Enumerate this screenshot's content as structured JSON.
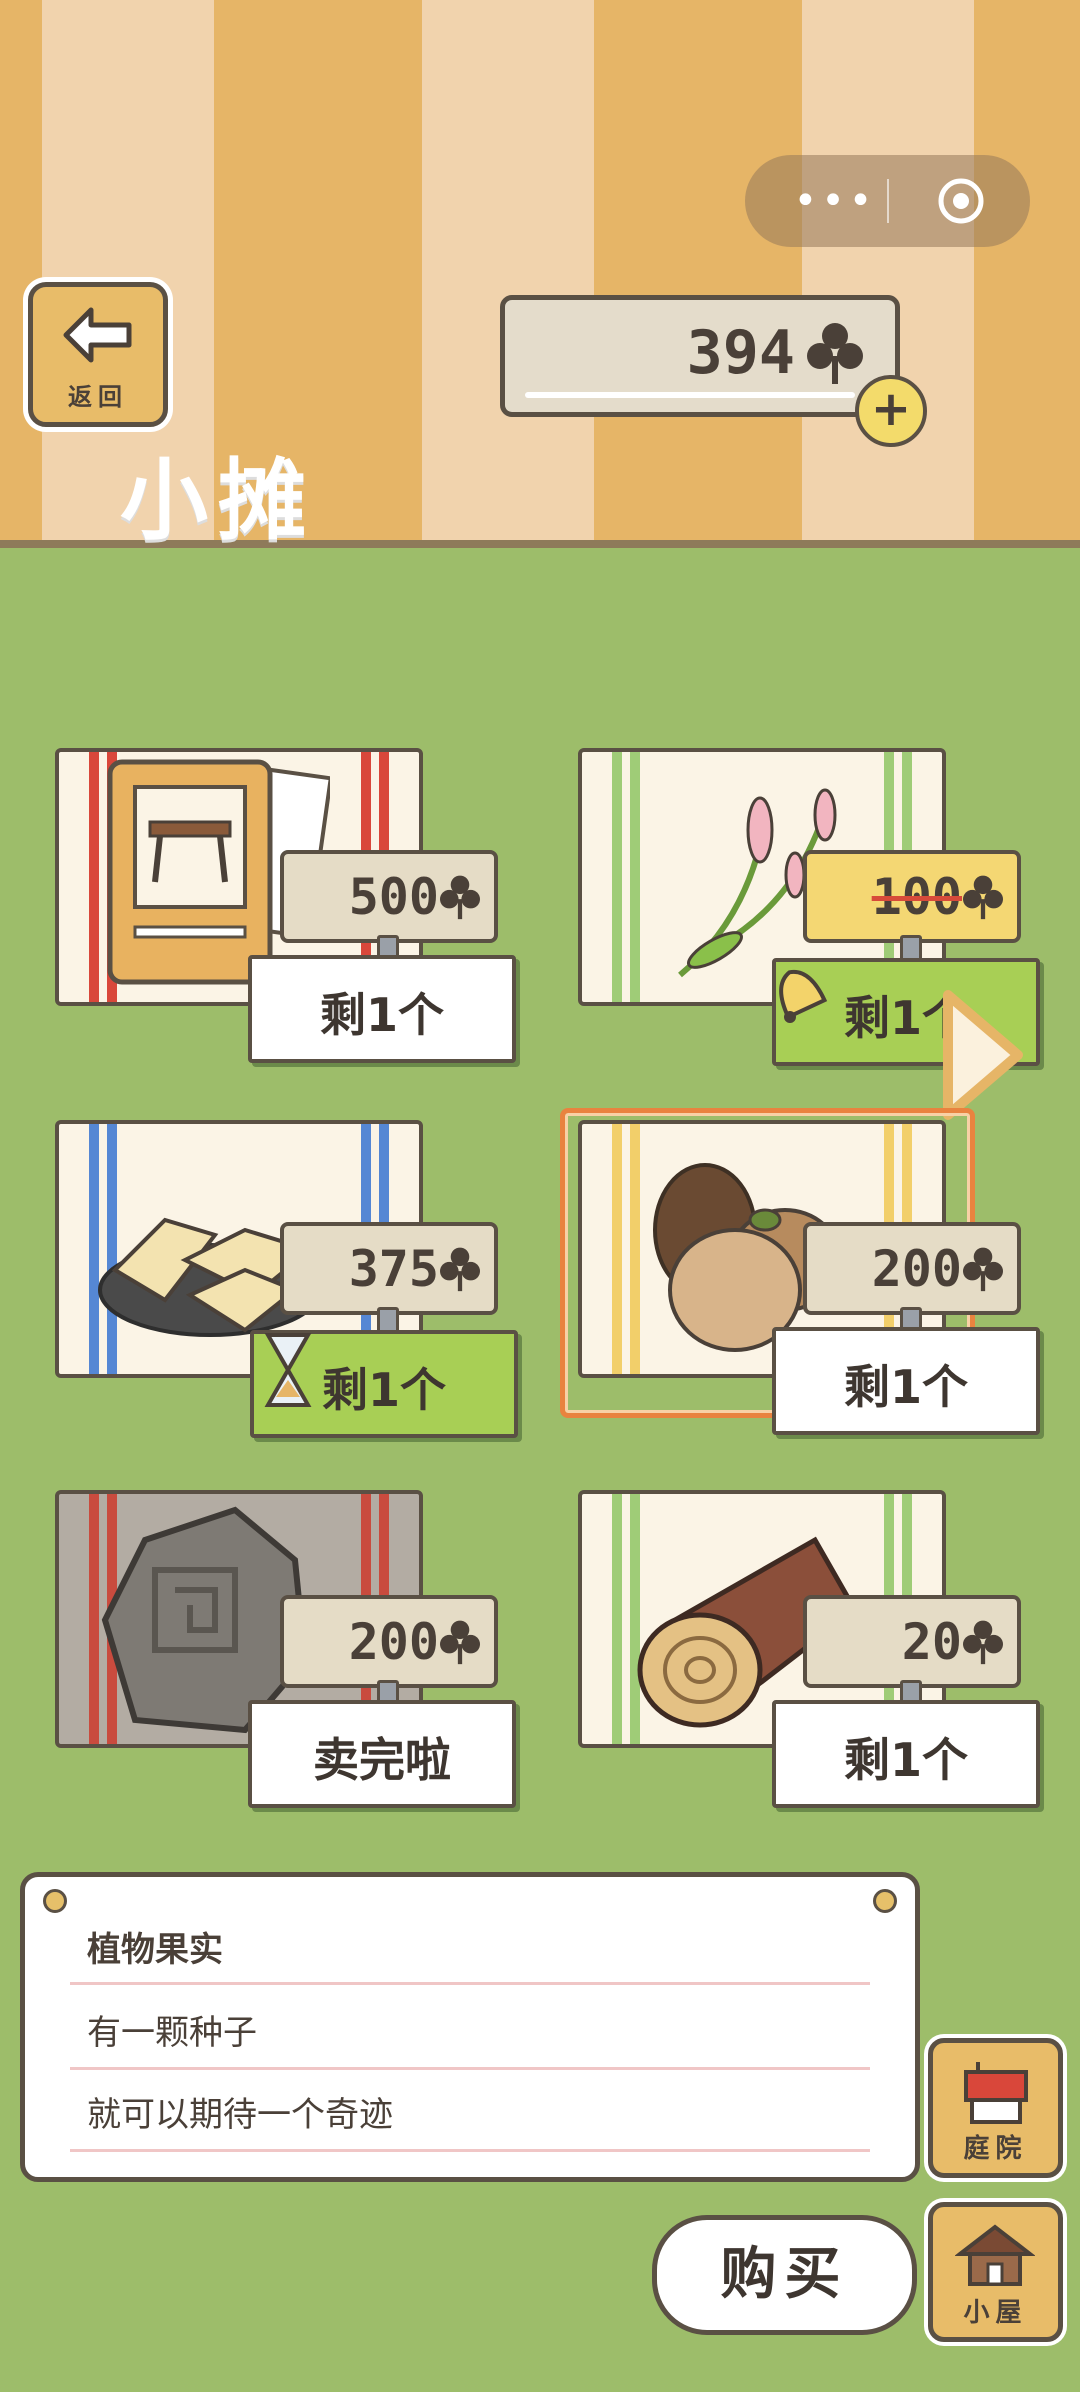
{
  "header": {
    "back_label": "返回",
    "clover_count": "394",
    "shop_title": "小摊",
    "capsule_icons": [
      "more-icon",
      "close-target-icon"
    ]
  },
  "items": [
    {
      "name": "furniture-card",
      "price": "500",
      "stock": "剩1个",
      "stripe": "#d9473a",
      "on_sale": false
    },
    {
      "name": "flower-item",
      "price": "100",
      "stock": "剩1个",
      "stripe": "#9fcc77",
      "on_sale": true
    },
    {
      "name": "food-item",
      "price": "375",
      "stock": "剩1个",
      "stripe": "#5587d4",
      "on_sale": false
    },
    {
      "name": "seed-item",
      "price": "200",
      "stock": "剩1个",
      "stripe": "#f2cf6a",
      "on_sale": false
    },
    {
      "name": "stone-item",
      "price": "200",
      "stock": "卖完啦",
      "stripe": "#c94b3e",
      "on_sale": false
    },
    {
      "name": "log-item",
      "price": "20",
      "stock": "剩1个",
      "stripe": "#9fcc77",
      "on_sale": false
    }
  ],
  "description": {
    "title": "植物果实",
    "line1": "有一颗种子",
    "line2": "就可以期待一个奇迹"
  },
  "buy_label": "购买",
  "side_buttons": {
    "yard": "庭院",
    "house": "小屋"
  },
  "colors": {
    "grass": "#9dbd6a",
    "stripe_orange": "#e6b567",
    "stripe_cream": "#f1d3ad",
    "selection": "#e9833f"
  }
}
